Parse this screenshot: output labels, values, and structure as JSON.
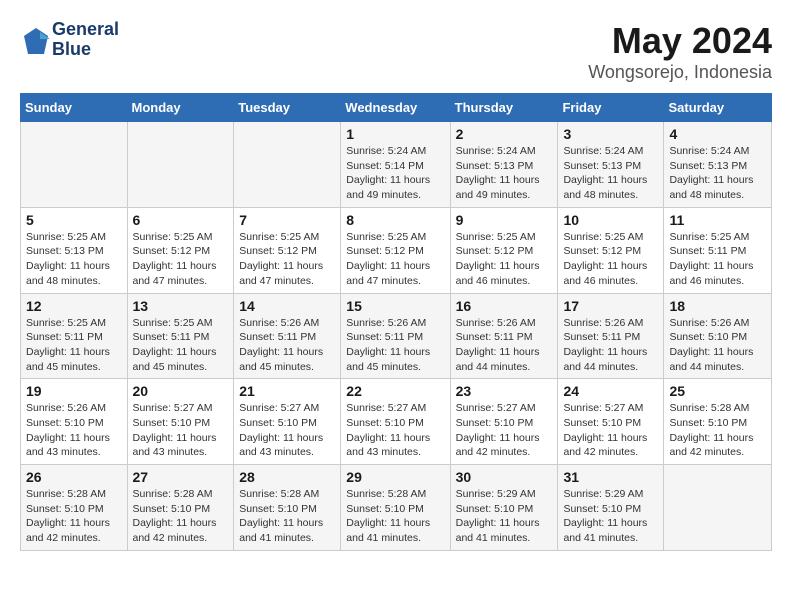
{
  "header": {
    "logo_line1": "General",
    "logo_line2": "Blue",
    "title": "May 2024",
    "subtitle": "Wongsorejo, Indonesia"
  },
  "days_of_week": [
    "Sunday",
    "Monday",
    "Tuesday",
    "Wednesday",
    "Thursday",
    "Friday",
    "Saturday"
  ],
  "weeks": [
    [
      {
        "day": "",
        "info": ""
      },
      {
        "day": "",
        "info": ""
      },
      {
        "day": "",
        "info": ""
      },
      {
        "day": "1",
        "info": "Sunrise: 5:24 AM\nSunset: 5:14 PM\nDaylight: 11 hours\nand 49 minutes."
      },
      {
        "day": "2",
        "info": "Sunrise: 5:24 AM\nSunset: 5:13 PM\nDaylight: 11 hours\nand 49 minutes."
      },
      {
        "day": "3",
        "info": "Sunrise: 5:24 AM\nSunset: 5:13 PM\nDaylight: 11 hours\nand 48 minutes."
      },
      {
        "day": "4",
        "info": "Sunrise: 5:24 AM\nSunset: 5:13 PM\nDaylight: 11 hours\nand 48 minutes."
      }
    ],
    [
      {
        "day": "5",
        "info": "Sunrise: 5:25 AM\nSunset: 5:13 PM\nDaylight: 11 hours\nand 48 minutes."
      },
      {
        "day": "6",
        "info": "Sunrise: 5:25 AM\nSunset: 5:12 PM\nDaylight: 11 hours\nand 47 minutes."
      },
      {
        "day": "7",
        "info": "Sunrise: 5:25 AM\nSunset: 5:12 PM\nDaylight: 11 hours\nand 47 minutes."
      },
      {
        "day": "8",
        "info": "Sunrise: 5:25 AM\nSunset: 5:12 PM\nDaylight: 11 hours\nand 47 minutes."
      },
      {
        "day": "9",
        "info": "Sunrise: 5:25 AM\nSunset: 5:12 PM\nDaylight: 11 hours\nand 46 minutes."
      },
      {
        "day": "10",
        "info": "Sunrise: 5:25 AM\nSunset: 5:12 PM\nDaylight: 11 hours\nand 46 minutes."
      },
      {
        "day": "11",
        "info": "Sunrise: 5:25 AM\nSunset: 5:11 PM\nDaylight: 11 hours\nand 46 minutes."
      }
    ],
    [
      {
        "day": "12",
        "info": "Sunrise: 5:25 AM\nSunset: 5:11 PM\nDaylight: 11 hours\nand 45 minutes."
      },
      {
        "day": "13",
        "info": "Sunrise: 5:25 AM\nSunset: 5:11 PM\nDaylight: 11 hours\nand 45 minutes."
      },
      {
        "day": "14",
        "info": "Sunrise: 5:26 AM\nSunset: 5:11 PM\nDaylight: 11 hours\nand 45 minutes."
      },
      {
        "day": "15",
        "info": "Sunrise: 5:26 AM\nSunset: 5:11 PM\nDaylight: 11 hours\nand 45 minutes."
      },
      {
        "day": "16",
        "info": "Sunrise: 5:26 AM\nSunset: 5:11 PM\nDaylight: 11 hours\nand 44 minutes."
      },
      {
        "day": "17",
        "info": "Sunrise: 5:26 AM\nSunset: 5:11 PM\nDaylight: 11 hours\nand 44 minutes."
      },
      {
        "day": "18",
        "info": "Sunrise: 5:26 AM\nSunset: 5:10 PM\nDaylight: 11 hours\nand 44 minutes."
      }
    ],
    [
      {
        "day": "19",
        "info": "Sunrise: 5:26 AM\nSunset: 5:10 PM\nDaylight: 11 hours\nand 43 minutes."
      },
      {
        "day": "20",
        "info": "Sunrise: 5:27 AM\nSunset: 5:10 PM\nDaylight: 11 hours\nand 43 minutes."
      },
      {
        "day": "21",
        "info": "Sunrise: 5:27 AM\nSunset: 5:10 PM\nDaylight: 11 hours\nand 43 minutes."
      },
      {
        "day": "22",
        "info": "Sunrise: 5:27 AM\nSunset: 5:10 PM\nDaylight: 11 hours\nand 43 minutes."
      },
      {
        "day": "23",
        "info": "Sunrise: 5:27 AM\nSunset: 5:10 PM\nDaylight: 11 hours\nand 42 minutes."
      },
      {
        "day": "24",
        "info": "Sunrise: 5:27 AM\nSunset: 5:10 PM\nDaylight: 11 hours\nand 42 minutes."
      },
      {
        "day": "25",
        "info": "Sunrise: 5:28 AM\nSunset: 5:10 PM\nDaylight: 11 hours\nand 42 minutes."
      }
    ],
    [
      {
        "day": "26",
        "info": "Sunrise: 5:28 AM\nSunset: 5:10 PM\nDaylight: 11 hours\nand 42 minutes."
      },
      {
        "day": "27",
        "info": "Sunrise: 5:28 AM\nSunset: 5:10 PM\nDaylight: 11 hours\nand 42 minutes."
      },
      {
        "day": "28",
        "info": "Sunrise: 5:28 AM\nSunset: 5:10 PM\nDaylight: 11 hours\nand 41 minutes."
      },
      {
        "day": "29",
        "info": "Sunrise: 5:28 AM\nSunset: 5:10 PM\nDaylight: 11 hours\nand 41 minutes."
      },
      {
        "day": "30",
        "info": "Sunrise: 5:29 AM\nSunset: 5:10 PM\nDaylight: 11 hours\nand 41 minutes."
      },
      {
        "day": "31",
        "info": "Sunrise: 5:29 AM\nSunset: 5:10 PM\nDaylight: 11 hours\nand 41 minutes."
      },
      {
        "day": "",
        "info": ""
      }
    ]
  ]
}
